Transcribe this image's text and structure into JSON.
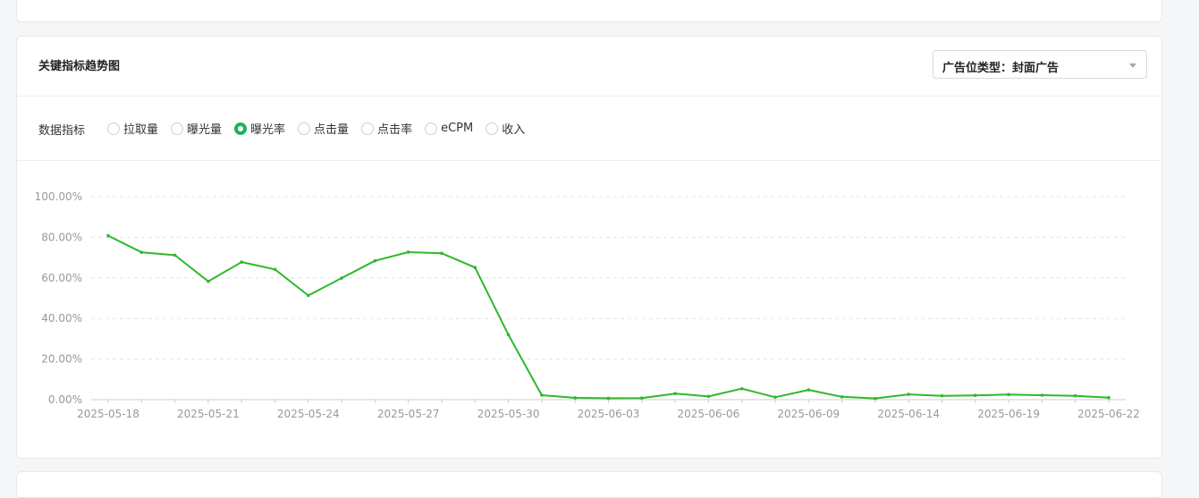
{
  "section": {
    "title": "关键指标趋势图",
    "ad_type_select": "广告位类型：封面广告"
  },
  "metrics": {
    "label": "数据指标",
    "options": [
      "拉取量",
      "曝光量",
      "曝光率",
      "点击量",
      "点击率",
      "eCPM",
      "收入"
    ],
    "selected": "曝光率"
  },
  "colors": {
    "line": "#2fb82b",
    "radio_active": "#1fb35a",
    "grid": "#e3e3e3"
  },
  "chart_data": {
    "type": "line",
    "title": "",
    "xlabel": "",
    "ylabel": "",
    "ylim": [
      0,
      100
    ],
    "y_ticks": [
      "0.00%",
      "20.00%",
      "40.00%",
      "60.00%",
      "80.00%",
      "100.00%"
    ],
    "x_tick_labels": [
      "2025-05-18",
      "2025-05-21",
      "2025-05-24",
      "2025-05-27",
      "2025-05-30",
      "2025-06-03",
      "2025-06-06",
      "2025-06-09",
      "2025-06-14",
      "2025-06-19",
      "2025-06-22"
    ],
    "grid": true,
    "values": [
      80.8,
      72.6,
      71.2,
      58.3,
      67.8,
      64.2,
      51.3,
      59.9,
      68.4,
      72.7,
      72.1,
      65.1,
      32.0,
      2.2,
      0.9,
      0.7,
      0.8,
      3.0,
      1.6,
      5.4,
      1.2,
      4.8,
      1.4,
      0.6,
      2.6,
      1.9,
      2.1,
      2.5,
      2.2,
      1.9,
      1.0
    ]
  }
}
